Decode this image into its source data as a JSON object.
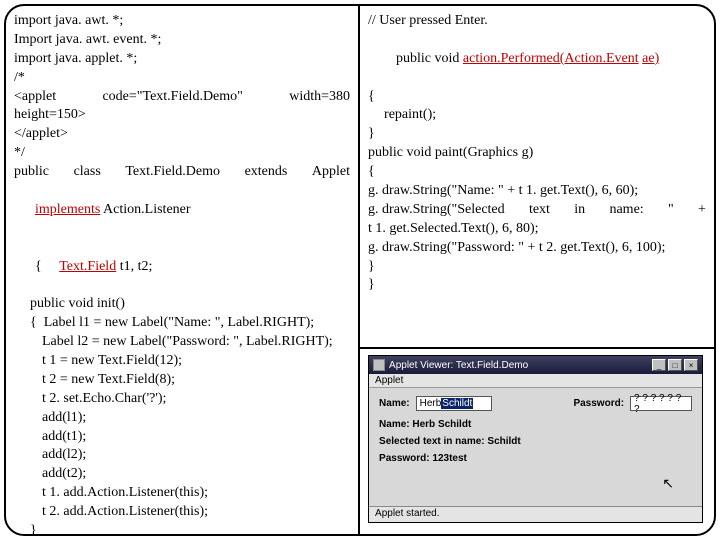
{
  "left": {
    "l1": "import java. awt. *;",
    "l2": "Import java. awt. event. *;",
    "l3": "import java. applet. *;",
    "l4": "/*",
    "l5a": "<applet",
    "l5b": "code=\"Text.Field.Demo\"",
    "l5c": "width=380",
    "l6": "height=150>",
    "l7": "</applet>",
    "l8": "*/",
    "l9a": "public",
    "l9b": "class",
    "l9c": "Text.Field.Demo",
    "l9d": "extends",
    "l9e": "Applet",
    "l10a": "implements",
    "l10b": " Action.Listener",
    "l11a": "{",
    "l11b": "Text.Field",
    "l11c": " t1, t2;",
    "l12": "public void init()",
    "l13": "{  Label l1 = new Label(\"Name: \", Label.RIGHT);",
    "l14": "Label l2 = new Label(\"Password: \", Label.RIGHT);",
    "l15": "t 1 = new Text.Field(12);",
    "l16": "t 2 = new Text.Field(8);",
    "l17": "t 2. set.Echo.Char('?');",
    "l18": "add(l1);",
    "l19": "add(t1);",
    "l20": "add(l2);",
    "l21": "add(t2);",
    "l22": "t 1. add.Action.Listener(this);",
    "l23": "t 2. add.Action.Listener(this);",
    "l24": "}"
  },
  "right": {
    "r1": "// User pressed Enter.",
    "r2a": "public void ",
    "r2b": "action.Performed(Action.Event",
    "r2c": " ",
    "r2d": "ae)",
    "r3": "{",
    "r4": "repaint();",
    "r5": "}",
    "r6": "public void paint(Graphics g)",
    "r7": "{",
    "r8": "g. draw.String(\"Name: \" + t 1. get.Text(), 6, 60);",
    "r9a": "g. draw.String(\"Selected",
    "r9b": "text",
    "r9c": "in",
    "r9d": "name:",
    "r9e": "\"",
    "r9f": "+",
    "r10": "t 1. get.Selected.Text(), 6, 80);",
    "r11": "g. draw.String(\"Password: \" + t 2. get.Text(), 6, 100);",
    "r12": "}",
    "r13": "}"
  },
  "applet": {
    "title": "Applet Viewer: Text.Field.Demo",
    "barLabel": "Applet",
    "nameLabel": "Name:",
    "nameValuePlain": "Herb ",
    "nameValueSel": "Schildt",
    "pwdLabel": "Password:",
    "pwdValue": "? ? ? ? ? ? ?",
    "out1": "Name: Herb Schildt",
    "out2": "Selected text in name: Schildt",
    "out3": "Password: 123test",
    "status": "Applet started."
  }
}
